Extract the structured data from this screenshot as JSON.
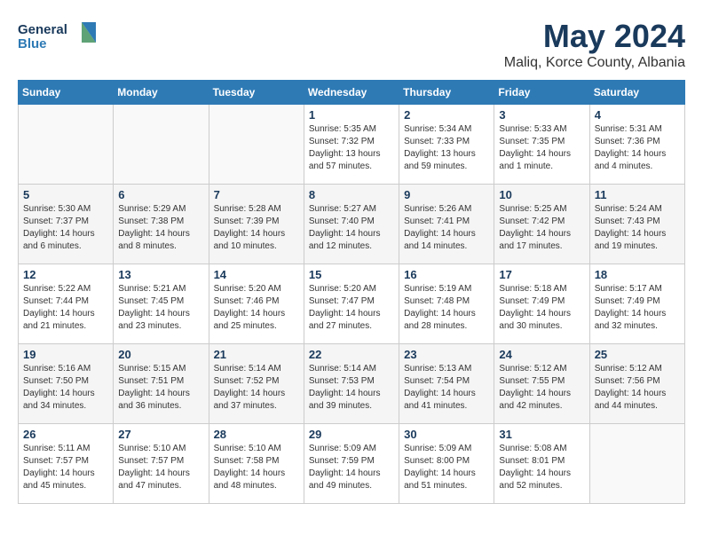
{
  "header": {
    "logo_line1": "General",
    "logo_line2": "Blue",
    "month": "May 2024",
    "location": "Maliq, Korce County, Albania"
  },
  "weekdays": [
    "Sunday",
    "Monday",
    "Tuesday",
    "Wednesday",
    "Thursday",
    "Friday",
    "Saturday"
  ],
  "weeks": [
    [
      {
        "day": "",
        "sunrise": "",
        "sunset": "",
        "daylight": "",
        "empty": true
      },
      {
        "day": "",
        "sunrise": "",
        "sunset": "",
        "daylight": "",
        "empty": true
      },
      {
        "day": "",
        "sunrise": "",
        "sunset": "",
        "daylight": "",
        "empty": true
      },
      {
        "day": "1",
        "sunrise": "Sunrise: 5:35 AM",
        "sunset": "Sunset: 7:32 PM",
        "daylight": "Daylight: 13 hours and 57 minutes.",
        "empty": false
      },
      {
        "day": "2",
        "sunrise": "Sunrise: 5:34 AM",
        "sunset": "Sunset: 7:33 PM",
        "daylight": "Daylight: 13 hours and 59 minutes.",
        "empty": false
      },
      {
        "day": "3",
        "sunrise": "Sunrise: 5:33 AM",
        "sunset": "Sunset: 7:35 PM",
        "daylight": "Daylight: 14 hours and 1 minute.",
        "empty": false
      },
      {
        "day": "4",
        "sunrise": "Sunrise: 5:31 AM",
        "sunset": "Sunset: 7:36 PM",
        "daylight": "Daylight: 14 hours and 4 minutes.",
        "empty": false
      }
    ],
    [
      {
        "day": "5",
        "sunrise": "Sunrise: 5:30 AM",
        "sunset": "Sunset: 7:37 PM",
        "daylight": "Daylight: 14 hours and 6 minutes.",
        "empty": false
      },
      {
        "day": "6",
        "sunrise": "Sunrise: 5:29 AM",
        "sunset": "Sunset: 7:38 PM",
        "daylight": "Daylight: 14 hours and 8 minutes.",
        "empty": false
      },
      {
        "day": "7",
        "sunrise": "Sunrise: 5:28 AM",
        "sunset": "Sunset: 7:39 PM",
        "daylight": "Daylight: 14 hours and 10 minutes.",
        "empty": false
      },
      {
        "day": "8",
        "sunrise": "Sunrise: 5:27 AM",
        "sunset": "Sunset: 7:40 PM",
        "daylight": "Daylight: 14 hours and 12 minutes.",
        "empty": false
      },
      {
        "day": "9",
        "sunrise": "Sunrise: 5:26 AM",
        "sunset": "Sunset: 7:41 PM",
        "daylight": "Daylight: 14 hours and 14 minutes.",
        "empty": false
      },
      {
        "day": "10",
        "sunrise": "Sunrise: 5:25 AM",
        "sunset": "Sunset: 7:42 PM",
        "daylight": "Daylight: 14 hours and 17 minutes.",
        "empty": false
      },
      {
        "day": "11",
        "sunrise": "Sunrise: 5:24 AM",
        "sunset": "Sunset: 7:43 PM",
        "daylight": "Daylight: 14 hours and 19 minutes.",
        "empty": false
      }
    ],
    [
      {
        "day": "12",
        "sunrise": "Sunrise: 5:22 AM",
        "sunset": "Sunset: 7:44 PM",
        "daylight": "Daylight: 14 hours and 21 minutes.",
        "empty": false
      },
      {
        "day": "13",
        "sunrise": "Sunrise: 5:21 AM",
        "sunset": "Sunset: 7:45 PM",
        "daylight": "Daylight: 14 hours and 23 minutes.",
        "empty": false
      },
      {
        "day": "14",
        "sunrise": "Sunrise: 5:20 AM",
        "sunset": "Sunset: 7:46 PM",
        "daylight": "Daylight: 14 hours and 25 minutes.",
        "empty": false
      },
      {
        "day": "15",
        "sunrise": "Sunrise: 5:20 AM",
        "sunset": "Sunset: 7:47 PM",
        "daylight": "Daylight: 14 hours and 27 minutes.",
        "empty": false
      },
      {
        "day": "16",
        "sunrise": "Sunrise: 5:19 AM",
        "sunset": "Sunset: 7:48 PM",
        "daylight": "Daylight: 14 hours and 28 minutes.",
        "empty": false
      },
      {
        "day": "17",
        "sunrise": "Sunrise: 5:18 AM",
        "sunset": "Sunset: 7:49 PM",
        "daylight": "Daylight: 14 hours and 30 minutes.",
        "empty": false
      },
      {
        "day": "18",
        "sunrise": "Sunrise: 5:17 AM",
        "sunset": "Sunset: 7:49 PM",
        "daylight": "Daylight: 14 hours and 32 minutes.",
        "empty": false
      }
    ],
    [
      {
        "day": "19",
        "sunrise": "Sunrise: 5:16 AM",
        "sunset": "Sunset: 7:50 PM",
        "daylight": "Daylight: 14 hours and 34 minutes.",
        "empty": false
      },
      {
        "day": "20",
        "sunrise": "Sunrise: 5:15 AM",
        "sunset": "Sunset: 7:51 PM",
        "daylight": "Daylight: 14 hours and 36 minutes.",
        "empty": false
      },
      {
        "day": "21",
        "sunrise": "Sunrise: 5:14 AM",
        "sunset": "Sunset: 7:52 PM",
        "daylight": "Daylight: 14 hours and 37 minutes.",
        "empty": false
      },
      {
        "day": "22",
        "sunrise": "Sunrise: 5:14 AM",
        "sunset": "Sunset: 7:53 PM",
        "daylight": "Daylight: 14 hours and 39 minutes.",
        "empty": false
      },
      {
        "day": "23",
        "sunrise": "Sunrise: 5:13 AM",
        "sunset": "Sunset: 7:54 PM",
        "daylight": "Daylight: 14 hours and 41 minutes.",
        "empty": false
      },
      {
        "day": "24",
        "sunrise": "Sunrise: 5:12 AM",
        "sunset": "Sunset: 7:55 PM",
        "daylight": "Daylight: 14 hours and 42 minutes.",
        "empty": false
      },
      {
        "day": "25",
        "sunrise": "Sunrise: 5:12 AM",
        "sunset": "Sunset: 7:56 PM",
        "daylight": "Daylight: 14 hours and 44 minutes.",
        "empty": false
      }
    ],
    [
      {
        "day": "26",
        "sunrise": "Sunrise: 5:11 AM",
        "sunset": "Sunset: 7:57 PM",
        "daylight": "Daylight: 14 hours and 45 minutes.",
        "empty": false
      },
      {
        "day": "27",
        "sunrise": "Sunrise: 5:10 AM",
        "sunset": "Sunset: 7:57 PM",
        "daylight": "Daylight: 14 hours and 47 minutes.",
        "empty": false
      },
      {
        "day": "28",
        "sunrise": "Sunrise: 5:10 AM",
        "sunset": "Sunset: 7:58 PM",
        "daylight": "Daylight: 14 hours and 48 minutes.",
        "empty": false
      },
      {
        "day": "29",
        "sunrise": "Sunrise: 5:09 AM",
        "sunset": "Sunset: 7:59 PM",
        "daylight": "Daylight: 14 hours and 49 minutes.",
        "empty": false
      },
      {
        "day": "30",
        "sunrise": "Sunrise: 5:09 AM",
        "sunset": "Sunset: 8:00 PM",
        "daylight": "Daylight: 14 hours and 51 minutes.",
        "empty": false
      },
      {
        "day": "31",
        "sunrise": "Sunrise: 5:08 AM",
        "sunset": "Sunset: 8:01 PM",
        "daylight": "Daylight: 14 hours and 52 minutes.",
        "empty": false
      },
      {
        "day": "",
        "sunrise": "",
        "sunset": "",
        "daylight": "",
        "empty": true
      }
    ]
  ]
}
